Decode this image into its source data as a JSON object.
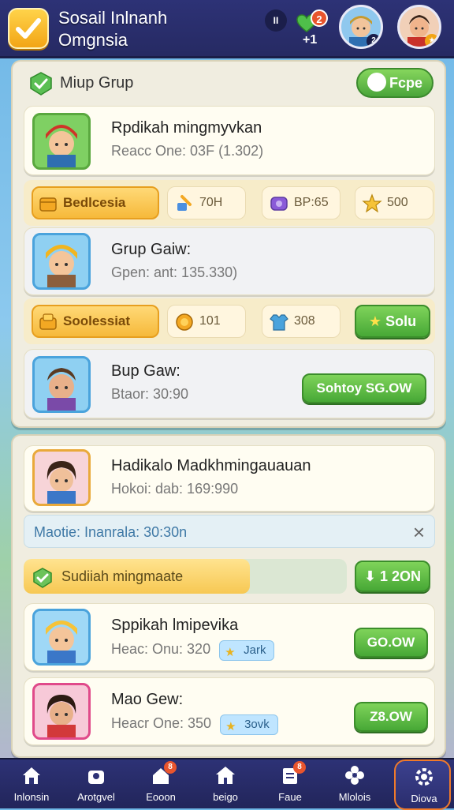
{
  "header": {
    "title_line1": "Sosail Inlnanh",
    "title_line2": "Omgnsia",
    "pause_label": "II",
    "hearts_badge": "2",
    "hearts_count": "+1",
    "avatar1_badge": "2",
    "avatar2_badge": "★"
  },
  "panel1": {
    "header_title": "Miup Grup",
    "header_button": "Fcpe",
    "card1": {
      "title": "Rpdikah mingmyvkan",
      "subtitle": "Reacc One: 03F (1.302)"
    },
    "stats1": {
      "main": "Bedlcesia",
      "box1": "70H",
      "box2": "BP:65",
      "box3": "500"
    },
    "card2": {
      "title": "Grup Gaiw:",
      "subtitle": "Gpen: ant: 135.330)"
    },
    "stats2": {
      "main": "Soolessiat",
      "box1": "101",
      "box2": "308",
      "button": "Solu"
    },
    "card3": {
      "title": "Bup Gaw:",
      "subtitle": "Btaor: 30:90",
      "button": "Sohtoy SG.OW"
    }
  },
  "panel2": {
    "card1": {
      "title": "Hadikalo Madkhmingauauan",
      "subtitle": "Hokoi: dab: 169:990"
    },
    "notice": {
      "text": "Maotie: Inanrala: 30:30n",
      "close": "×"
    },
    "progress": {
      "label": "Sudiiah mingmaate",
      "value": 0.7,
      "button": "1 2ON"
    },
    "card2": {
      "title": "Sppikah lmipevika",
      "subtitle": "Heac: Onu: 320",
      "tag": "Jark",
      "button": "GO.OW"
    },
    "card3": {
      "title": "Mao Gew:",
      "subtitle": "Heacr One: 350",
      "tag": "3ovk",
      "button": "Z8.OW"
    }
  },
  "nav": {
    "items": [
      {
        "label": "Inlonsin"
      },
      {
        "label": "Arotgvel"
      },
      {
        "label": "Eooon",
        "badge": "8"
      },
      {
        "label": "beigo"
      },
      {
        "label": "Faue",
        "badge": "8"
      },
      {
        "label": "Mlolois"
      },
      {
        "label": "Diova"
      }
    ]
  }
}
